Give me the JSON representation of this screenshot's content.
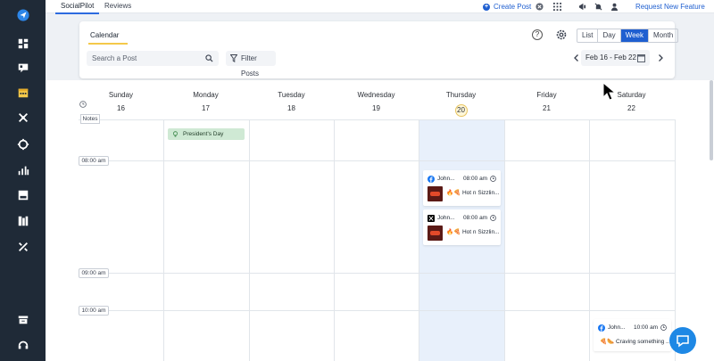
{
  "topbar": {
    "tabs": [
      {
        "label": "SocialPilot",
        "active": true
      },
      {
        "label": "Reviews",
        "active": false
      }
    ],
    "create_post": "Create Post",
    "request_feature": "Request New Feature"
  },
  "sidebar": {
    "items": [
      {
        "icon": "send-icon",
        "active": true
      },
      {
        "icon": "dashboard-icon"
      },
      {
        "icon": "inbox-icon"
      },
      {
        "icon": "calendar-icon",
        "active": true
      },
      {
        "icon": "connect-icon"
      },
      {
        "icon": "target-icon"
      },
      {
        "icon": "analytics-icon"
      },
      {
        "icon": "content-icon"
      },
      {
        "icon": "library-icon"
      },
      {
        "icon": "tools-icon"
      },
      {
        "icon": "archive-icon"
      },
      {
        "icon": "support-icon"
      }
    ]
  },
  "header": {
    "title": "Calendar",
    "search_placeholder": "Search a Post",
    "filter_label": "Filter Posts",
    "help_label": "?",
    "views": [
      {
        "label": "List",
        "active": false
      },
      {
        "label": "Day",
        "active": false
      },
      {
        "label": "Week",
        "active": true
      },
      {
        "label": "Month",
        "active": false
      }
    ],
    "date_range": "Feb 16 - Feb 22"
  },
  "calendar": {
    "notes_label": "Notes",
    "days": [
      {
        "name": "Sunday",
        "num": "16"
      },
      {
        "name": "Monday",
        "num": "17"
      },
      {
        "name": "Tuesday",
        "num": "18"
      },
      {
        "name": "Wednesday",
        "num": "19"
      },
      {
        "name": "Thursday",
        "num": "20",
        "today": true
      },
      {
        "name": "Friday",
        "num": "21"
      },
      {
        "name": "Saturday",
        "num": "22"
      }
    ],
    "time_labels": [
      "08:00 am",
      "09:00 am",
      "10:00 am"
    ],
    "holiday": "President's Day",
    "posts": [
      {
        "network": "facebook-icon",
        "author": "John...",
        "time": "08:00 am",
        "caption": "🔥🍕 Hot n Sizzlin..."
      },
      {
        "network": "x-icon",
        "author": "John...",
        "time": "08:00 am",
        "caption": "🔥🍕 Hot n Sizzlin..."
      },
      {
        "network": "facebook-icon",
        "author": "John...",
        "time": "10:00 am",
        "caption": "🍕🌭 Craving something ..."
      }
    ]
  },
  "colors": {
    "sidebar_bg": "#1f2a37",
    "accent": "#1f5fd0",
    "today_column": "#e8f0fb",
    "holiday_bg": "#cfe9d4",
    "tab_underline": "#f4c94a"
  }
}
